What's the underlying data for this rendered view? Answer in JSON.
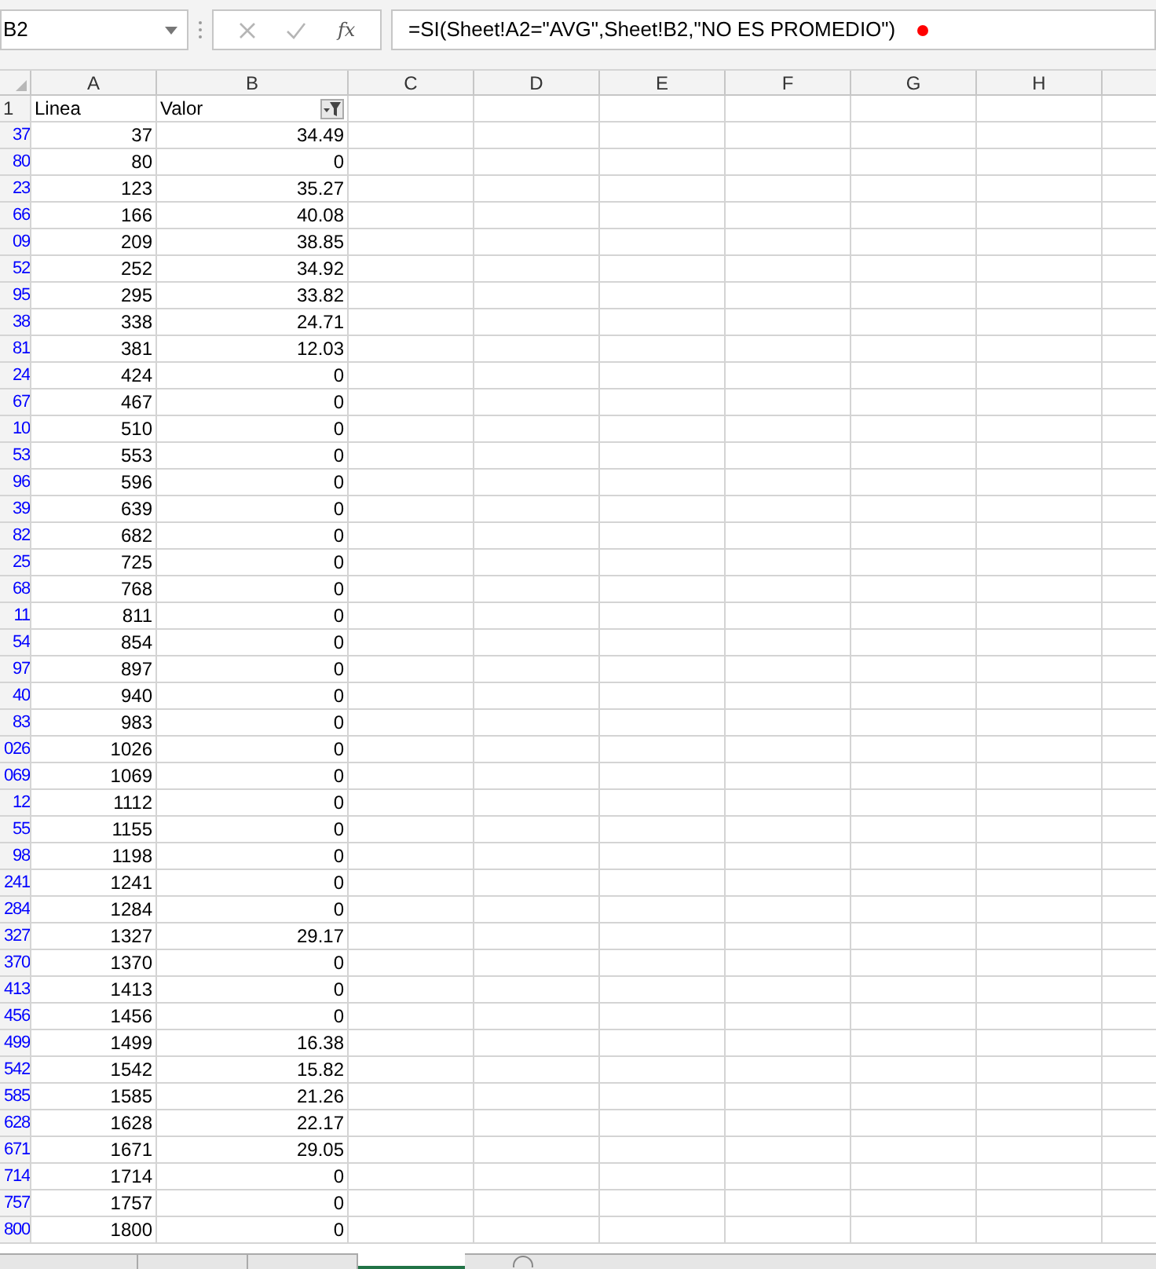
{
  "name_box": {
    "value": "B2"
  },
  "formula_bar": {
    "fx": "fx",
    "formula": "=SI(Sheet!A2=\"AVG\",Sheet!B2,\"NO ES PROMEDIO\")"
  },
  "columns": [
    "A",
    "B",
    "C",
    "D",
    "E",
    "F",
    "G",
    "H"
  ],
  "header_row": {
    "row_header": "1",
    "cells": [
      "Linea",
      "Valor"
    ],
    "filter_on": true
  },
  "rows": [
    {
      "row_header": "37",
      "a": "37",
      "b": "34.49"
    },
    {
      "row_header": "80",
      "a": "80",
      "b": "0"
    },
    {
      "row_header": "23",
      "a": "123",
      "b": "35.27"
    },
    {
      "row_header": "66",
      "a": "166",
      "b": "40.08"
    },
    {
      "row_header": "09",
      "a": "209",
      "b": "38.85"
    },
    {
      "row_header": "52",
      "a": "252",
      "b": "34.92"
    },
    {
      "row_header": "95",
      "a": "295",
      "b": "33.82"
    },
    {
      "row_header": "38",
      "a": "338",
      "b": "24.71"
    },
    {
      "row_header": "81",
      "a": "381",
      "b": "12.03"
    },
    {
      "row_header": "24",
      "a": "424",
      "b": "0"
    },
    {
      "row_header": "67",
      "a": "467",
      "b": "0"
    },
    {
      "row_header": "10",
      "a": "510",
      "b": "0"
    },
    {
      "row_header": "53",
      "a": "553",
      "b": "0"
    },
    {
      "row_header": "96",
      "a": "596",
      "b": "0"
    },
    {
      "row_header": "39",
      "a": "639",
      "b": "0"
    },
    {
      "row_header": "82",
      "a": "682",
      "b": "0"
    },
    {
      "row_header": "25",
      "a": "725",
      "b": "0"
    },
    {
      "row_header": "68",
      "a": "768",
      "b": "0"
    },
    {
      "row_header": "11",
      "a": "811",
      "b": "0"
    },
    {
      "row_header": "54",
      "a": "854",
      "b": "0"
    },
    {
      "row_header": "97",
      "a": "897",
      "b": "0"
    },
    {
      "row_header": "40",
      "a": "940",
      "b": "0"
    },
    {
      "row_header": "83",
      "a": "983",
      "b": "0"
    },
    {
      "row_header": "026",
      "a": "1026",
      "b": "0"
    },
    {
      "row_header": "069",
      "a": "1069",
      "b": "0"
    },
    {
      "row_header": "12",
      "a": "1112",
      "b": "0"
    },
    {
      "row_header": "55",
      "a": "1155",
      "b": "0"
    },
    {
      "row_header": "98",
      "a": "1198",
      "b": "0"
    },
    {
      "row_header": "241",
      "a": "1241",
      "b": "0"
    },
    {
      "row_header": "284",
      "a": "1284",
      "b": "0"
    },
    {
      "row_header": "327",
      "a": "1327",
      "b": "29.17"
    },
    {
      "row_header": "370",
      "a": "1370",
      "b": "0"
    },
    {
      "row_header": "413",
      "a": "1413",
      "b": "0"
    },
    {
      "row_header": "456",
      "a": "1456",
      "b": "0"
    },
    {
      "row_header": "499",
      "a": "1499",
      "b": "16.38"
    },
    {
      "row_header": "542",
      "a": "1542",
      "b": "15.82"
    },
    {
      "row_header": "585",
      "a": "1585",
      "b": "21.26"
    },
    {
      "row_header": "628",
      "a": "1628",
      "b": "22.17"
    },
    {
      "row_header": "671",
      "a": "1671",
      "b": "29.05"
    },
    {
      "row_header": "714",
      "a": "1714",
      "b": "0"
    },
    {
      "row_header": "757",
      "a": "1757",
      "b": "0"
    },
    {
      "row_header": "800",
      "a": "1800",
      "b": "0"
    }
  ],
  "sheet_tabs": [
    {
      "selected": false
    },
    {
      "selected": false
    },
    {
      "selected": true
    }
  ]
}
